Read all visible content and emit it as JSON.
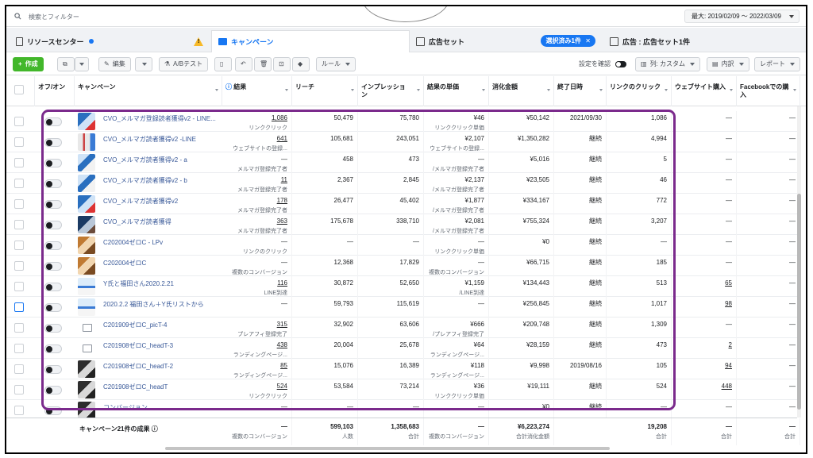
{
  "search": {
    "placeholder": "検索とフィルター"
  },
  "date_range": "最大: 2019/02/09 〜 2022/03/09",
  "tabs": {
    "resource_center": "リソースセンター",
    "campaign": "キャンペーン",
    "adset": "広告セット",
    "selected_pill": "選択済み1件",
    "ad": "広告 : 広告セット1件"
  },
  "toolbar": {
    "create": "作成",
    "edit": "編集",
    "ab_test": "A/Bテスト",
    "rules": "ルール",
    "settings_check": "設定を確認",
    "columns": "列: カスタム",
    "breakdown": "内訳",
    "report": "レポート"
  },
  "headers": {
    "onoff": "オフ/オン",
    "campaign": "キャンペーン",
    "results": "結果",
    "reach": "リーチ",
    "impressions": "インプレッション",
    "cost_per_result": "結果の単価",
    "amount_spent": "消化金額",
    "end_date": "終了日時",
    "link_clicks": "リンクのクリック",
    "website_purchases": "ウェブサイト購入",
    "facebook_purchases": "Facebookでの購入"
  },
  "rows": [
    {
      "name": "CVO_メルマガ登録読者獲得v2 - LINE...",
      "results": "1,086",
      "results_sub": "リンククリック",
      "reach": "50,479",
      "impr": "75,780",
      "cpr": "¥46",
      "cpr_sub": "リンククリック単価",
      "spent": "¥50,142",
      "end": "2021/09/30",
      "clicks": "1,086",
      "wp": "—",
      "fp": "—"
    },
    {
      "name": "CVO_メルマガ読者獲得v2 -LINE",
      "results": "641",
      "results_sub": "ウェブサイトの登録...",
      "reach": "105,681",
      "impr": "243,051",
      "cpr": "¥2,107",
      "cpr_sub": "ウェブサイトの登録...",
      "spent": "¥1,350,282",
      "end": "継続",
      "clicks": "4,994",
      "wp": "—",
      "fp": "—"
    },
    {
      "name": "CVO_メルマガ読者獲得v2 - a",
      "results": "—",
      "results_sub": "メルマガ登録完了者",
      "reach": "458",
      "impr": "473",
      "cpr": "—",
      "cpr_sub": "/メルマガ登録完了者",
      "spent": "¥5,016",
      "end": "継続",
      "clicks": "5",
      "wp": "—",
      "fp": "—"
    },
    {
      "name": "CVO_メルマガ読者獲得v2 - b",
      "results": "11",
      "results_sub": "メルマガ登録完了者",
      "reach": "2,367",
      "impr": "2,845",
      "cpr": "¥2,137",
      "cpr_sub": "/メルマガ登録完了者",
      "spent": "¥23,505",
      "end": "継続",
      "clicks": "46",
      "wp": "—",
      "fp": "—"
    },
    {
      "name": "CVO_メルマガ読者獲得v2",
      "results": "178",
      "results_sub": "メルマガ登録完了者",
      "reach": "26,477",
      "impr": "45,402",
      "cpr": "¥1,877",
      "cpr_sub": "/メルマガ登録完了者",
      "spent": "¥334,167",
      "end": "継続",
      "clicks": "772",
      "wp": "—",
      "fp": "—"
    },
    {
      "name": "CVO_メルマガ読者獲得",
      "results": "363",
      "results_sub": "メルマガ登録完了者",
      "reach": "175,678",
      "impr": "338,710",
      "cpr": "¥2,081",
      "cpr_sub": "/メルマガ登録完了者",
      "spent": "¥755,324",
      "end": "継続",
      "clicks": "3,207",
      "wp": "—",
      "fp": "—"
    },
    {
      "name": "C202004ゼロC - LPv",
      "results": "—",
      "results_sub": "リンクのクリック",
      "reach": "—",
      "impr": "—",
      "cpr": "—",
      "cpr_sub": "リンククリック単価",
      "spent": "¥0",
      "end": "継続",
      "clicks": "—",
      "wp": "—",
      "fp": "—"
    },
    {
      "name": "C202004ゼロC",
      "results": "—",
      "results_sub": "複数のコンバージョン",
      "reach": "12,368",
      "impr": "17,829",
      "cpr": "—",
      "cpr_sub": "複数のコンバージョン",
      "spent": "¥66,715",
      "end": "継続",
      "clicks": "185",
      "wp": "—",
      "fp": "—"
    },
    {
      "name": "Y氏と福田さん2020.2.21",
      "results": "116",
      "results_sub": "LINE到達",
      "reach": "30,872",
      "impr": "52,650",
      "cpr": "¥1,159",
      "cpr_sub": "/LINE到達",
      "spent": "¥134,443",
      "end": "継続",
      "clicks": "513",
      "wp": "65",
      "fp": "—"
    },
    {
      "name": "2020.2.2 福田さん＋Y氏リストから",
      "results": "—",
      "results_sub": "",
      "reach": "59,793",
      "impr": "115,619",
      "cpr": "—",
      "cpr_sub": "",
      "spent": "¥256,845",
      "end": "継続",
      "clicks": "1,017",
      "wp": "98",
      "fp": "—"
    },
    {
      "name": "C201909ゼロC_picT-4",
      "results": "315",
      "results_sub": "プレアフィ登録完了",
      "reach": "32,902",
      "impr": "63,606",
      "cpr": "¥666",
      "cpr_sub": "/プレアフィ登録完了",
      "spent": "¥209,748",
      "end": "継続",
      "clicks": "1,309",
      "wp": "—",
      "fp": "—"
    },
    {
      "name": "C201908ゼロC_headT-3",
      "results": "438",
      "results_sub": "ランディングページ...",
      "reach": "20,004",
      "impr": "25,678",
      "cpr": "¥64",
      "cpr_sub": "ランディングページ...",
      "spent": "¥28,159",
      "end": "継続",
      "clicks": "473",
      "wp": "2",
      "fp": "—"
    },
    {
      "name": "C201908ゼロC_headT-2",
      "results": "85",
      "results_sub": "ランディングページ...",
      "reach": "15,076",
      "impr": "16,389",
      "cpr": "¥118",
      "cpr_sub": "ランディングページ...",
      "spent": "¥9,998",
      "end": "2019/08/16",
      "clicks": "105",
      "wp": "94",
      "fp": "—"
    },
    {
      "name": "C201908ゼロC_headT",
      "results": "524",
      "results_sub": "リンククリック",
      "reach": "53,584",
      "impr": "73,214",
      "cpr": "¥36",
      "cpr_sub": "リンククリック単価",
      "spent": "¥19,111",
      "end": "継続",
      "clicks": "524",
      "wp": "448",
      "fp": "—"
    },
    {
      "name": "コンバージョン",
      "results": "—",
      "results_sub": "",
      "reach": "—",
      "impr": "—",
      "cpr": "—",
      "cpr_sub": "",
      "spent": "¥0",
      "end": "継続",
      "clicks": "—",
      "wp": "—",
      "fp": "—"
    }
  ],
  "totals": {
    "label": "キャンペーン21件の成果",
    "results": "—",
    "results_sub": "複数のコンバージョン",
    "reach": "599,103",
    "reach_sub": "人数",
    "impr": "1,358,683",
    "impr_sub": "合計",
    "cpr": "—",
    "cpr_sub": "複数のコンバージョン",
    "spent": "¥6,223,274",
    "spent_sub": "合計消化金額",
    "end": "",
    "clicks": "19,208",
    "clicks_sub": "合計",
    "wp": "—",
    "wp_sub": "合計",
    "fp": "—",
    "fp_sub": "合計"
  },
  "colors": {
    "highlight": "#7b2a8c",
    "accent": "#1877f2",
    "create": "#42b72a"
  }
}
